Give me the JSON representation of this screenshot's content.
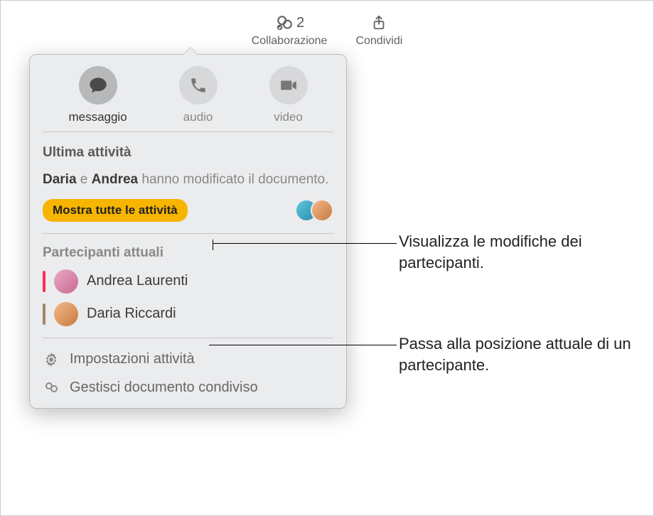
{
  "topbar": {
    "collab_label": "Collaborazione",
    "collab_count": "2",
    "share_label": "Condividi"
  },
  "comm": {
    "message": "messaggio",
    "audio": "audio",
    "video": "video"
  },
  "activity": {
    "title": "Ultima attività",
    "name1": "Daria",
    "connector": " e ",
    "name2": "Andrea",
    "rest": " hanno modificato il documento.",
    "show_all": "Mostra tutte le attività"
  },
  "participants": {
    "title": "Partecipanti attuali",
    "list": [
      {
        "name": "Andrea Laurenti",
        "color": "#ff2d55",
        "avatar_bg": "linear-gradient(135deg,#e9a8c3,#c96a95)"
      },
      {
        "name": "Daria Riccardi",
        "color": "#a3866b",
        "avatar_bg": "linear-gradient(135deg,#f2b98a,#c97a3d)"
      }
    ]
  },
  "actions": {
    "settings": "Impostazioni attività",
    "manage": "Gestisci documento condiviso"
  },
  "callouts": {
    "c1": "Visualizza le modifiche dei partecipanti.",
    "c2": "Passa alla posizione attuale di un partecipante."
  }
}
